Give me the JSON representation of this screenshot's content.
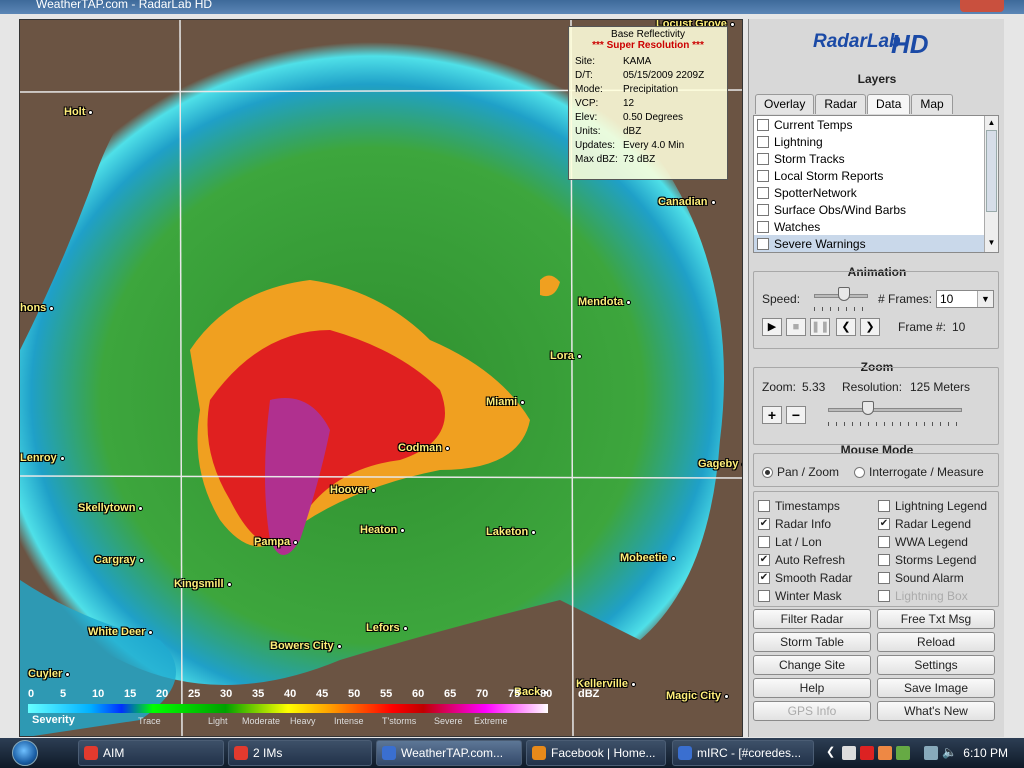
{
  "window": {
    "title": "WeatherTAP.com - RadarLab HD"
  },
  "map": {
    "info": {
      "header": "Base Reflectivity",
      "super_res": "*** Super Resolution ***",
      "rows": [
        {
          "k": "Site:",
          "v": "KAMA"
        },
        {
          "k": "D/T:",
          "v": "05/15/2009 2209Z"
        },
        {
          "k": "Mode:",
          "v": "Precipitation"
        },
        {
          "k": "VCP:",
          "v": "12"
        },
        {
          "k": "Elev:",
          "v": "0.50 Degrees"
        },
        {
          "k": "Units:",
          "v": "dBZ"
        },
        {
          "k": "Updates:",
          "v": "Every 4.0 Min"
        },
        {
          "k": "Max dBZ:",
          "v": "73 dBZ"
        }
      ]
    },
    "cities": [
      "Holt",
      "Canadian",
      "Mendota",
      "Lora",
      "Miami",
      "Codman",
      "Gageby",
      "Hoover",
      "Heaton",
      "Laketon",
      "Skellytown",
      "Pampa",
      "Cargray",
      "Kingsmill",
      "Mobeetie",
      "White Deer",
      "Lefors",
      "Bowers City",
      "Cuyler",
      "Kellerville",
      "Magic City",
      "Back",
      "Lenroy",
      "hons",
      "Locust Grove"
    ],
    "legend": {
      "ticks": [
        "0",
        "5",
        "10",
        "15",
        "20",
        "25",
        "30",
        "35",
        "40",
        "45",
        "50",
        "55",
        "60",
        "65",
        "70",
        "75",
        "80",
        "dBZ"
      ],
      "severity_label": "Severity",
      "severity": [
        "Trace",
        "Light",
        "Moderate",
        "Heavy",
        "Intense",
        "T'storms",
        "Severe",
        "Extreme"
      ]
    }
  },
  "panel": {
    "logo": {
      "text": "RadarLab",
      "suffix": "HD"
    },
    "layers_title": "Layers",
    "tabs": [
      "Overlay",
      "Radar",
      "Data",
      "Map"
    ],
    "active_tab": "Data",
    "layers": [
      "Current Temps",
      "Lightning",
      "Storm Tracks",
      "Local Storm Reports",
      "SpotterNetwork",
      "Surface Obs/Wind Barbs",
      "Watches",
      "Severe Warnings"
    ],
    "animation": {
      "title": "Animation",
      "speed_label": "Speed:",
      "frames_label": "# Frames:",
      "frames_value": "10",
      "frame_label": "Frame #:",
      "frame_value": "10",
      "speed_level": 0.55
    },
    "zoom": {
      "title": "Zoom",
      "zoom_label": "Zoom:",
      "zoom_value": "5.33",
      "resolution_label": "Resolution:",
      "resolution_value": "125 Meters",
      "plus": "+",
      "minus": "−",
      "zoom_level": 0.3
    },
    "mouse_mode": {
      "title": "Mouse Mode",
      "options": [
        "Pan / Zoom",
        "Interrogate / Measure"
      ],
      "selected": "Pan / Zoom"
    },
    "options": [
      {
        "label": "Timestamps",
        "checked": false,
        "disabled": false
      },
      {
        "label": "Radar Info",
        "checked": true,
        "disabled": false
      },
      {
        "label": "Lat / Lon",
        "checked": false,
        "disabled": false
      },
      {
        "label": "Auto Refresh",
        "checked": true,
        "disabled": false
      },
      {
        "label": "Smooth Radar",
        "checked": true,
        "disabled": false
      },
      {
        "label": "Winter Mask",
        "checked": false,
        "disabled": false
      },
      {
        "label": "Lightning Legend",
        "checked": false,
        "disabled": false
      },
      {
        "label": "Radar Legend",
        "checked": true,
        "disabled": false
      },
      {
        "label": "WWA Legend",
        "checked": false,
        "disabled": false
      },
      {
        "label": "Storms Legend",
        "checked": false,
        "disabled": false
      },
      {
        "label": "Sound Alarm",
        "checked": false,
        "disabled": false
      },
      {
        "label": "Lightning Box",
        "checked": false,
        "disabled": true
      }
    ],
    "buttons": [
      {
        "label": "Filter Radar",
        "disabled": false
      },
      {
        "label": "Free Txt Msg",
        "disabled": false
      },
      {
        "label": "Storm Table",
        "disabled": false
      },
      {
        "label": "Reload",
        "disabled": false
      },
      {
        "label": "Change Site",
        "disabled": false
      },
      {
        "label": "Settings",
        "disabled": false
      },
      {
        "label": "Help",
        "disabled": false
      },
      {
        "label": "Save Image",
        "disabled": false
      },
      {
        "label": "GPS Info",
        "disabled": true
      },
      {
        "label": "What's New",
        "disabled": false
      }
    ]
  },
  "taskbar": {
    "items": [
      {
        "label": "AIM",
        "color": "#e23a2e"
      },
      {
        "label": "2 IMs",
        "color": "#e23a2e"
      },
      {
        "label": "WeatherTAP.com...",
        "color": "#3a6fd0",
        "active": true
      },
      {
        "label": "Facebook | Home...",
        "color": "#e88a1a"
      },
      {
        "label": "mIRC - [#coredes...",
        "color": "#3a6fd0"
      }
    ],
    "clock": "6:10 PM"
  }
}
